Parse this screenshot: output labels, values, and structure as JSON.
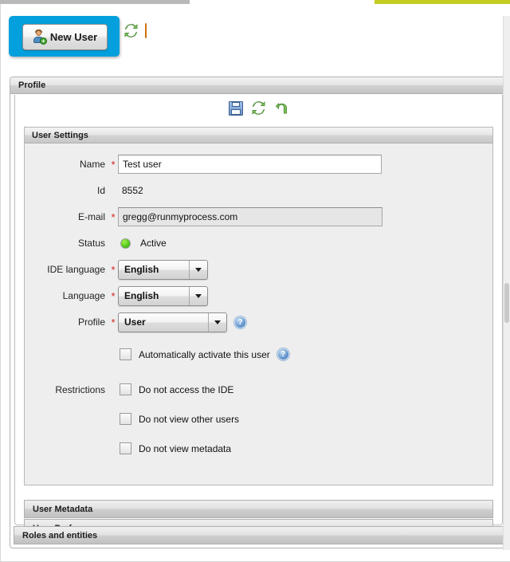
{
  "window": {
    "accent_blue": "#049fdd",
    "accent_green": "#c3cd22"
  },
  "toolbar": {
    "new_user_label": "New User",
    "icons": [
      {
        "name": "refresh-icon"
      },
      {
        "name": "rss-icon"
      }
    ]
  },
  "profile_panel": {
    "title": "Profile",
    "form_toolbar": [
      {
        "name": "save-icon"
      },
      {
        "name": "refresh-icon"
      },
      {
        "name": "revert-icon"
      }
    ]
  },
  "user_settings": {
    "legend": "User Settings",
    "fields": {
      "name": {
        "label": "Name",
        "value": "Test user",
        "required": "*"
      },
      "id": {
        "label": "Id",
        "value": "8552"
      },
      "email": {
        "label": "E-mail",
        "value": "gregg@runmyprocess.com",
        "required": "*"
      },
      "status": {
        "label": "Status",
        "value": "Active",
        "color": "#4fc51d"
      },
      "ide_language": {
        "label": "IDE language",
        "value": "English",
        "required": "*"
      },
      "language": {
        "label": "Language",
        "value": "English",
        "required": "*"
      },
      "profile": {
        "label": "Profile",
        "value": "User",
        "required": "*",
        "help": "?"
      }
    },
    "auto_activate": {
      "label": "Automatically activate this user",
      "checked": false,
      "help": "?"
    },
    "restrictions": {
      "label": "Restrictions",
      "items": [
        {
          "label": "Do not access the IDE",
          "checked": false
        },
        {
          "label": "Do not view other users",
          "checked": false
        },
        {
          "label": "Do not view metadata",
          "checked": false
        }
      ]
    }
  },
  "sections": {
    "user_metadata": "User Metadata",
    "user_preferences": "User Preferences",
    "roles_and_entities": "Roles and entities"
  }
}
